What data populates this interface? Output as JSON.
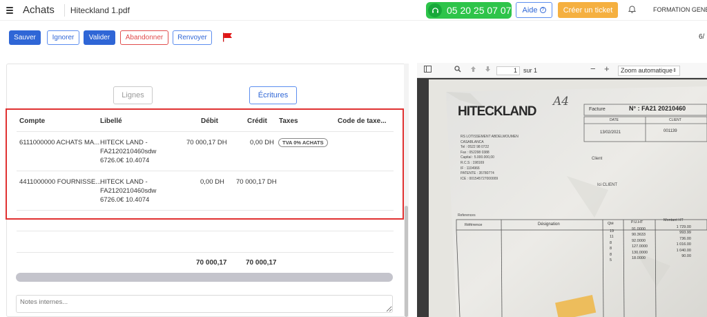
{
  "topbar": {
    "app_title": "Achats",
    "file_name": "Hiteckland 1.pdf",
    "phone": "05 20 25 07 07",
    "help_label": "Aide",
    "ticket_label": "Créer un ticket",
    "company": "FORMATION GENE"
  },
  "toolbar": {
    "save_label": "Sauver",
    "ignore_label": "Ignorer",
    "validate_label": "Valider",
    "abandon_label": "Abandonner",
    "resend_label": "Renvoyer",
    "pager": "6/"
  },
  "tabs": {
    "lines_label": "Lignes",
    "entries_label": "Écritures"
  },
  "table": {
    "headers": {
      "account": "Compte",
      "label": "Libellé",
      "debit": "Débit",
      "credit": "Crédit",
      "taxes": "Taxes",
      "tax_code": "Code de taxe..."
    },
    "rows": [
      {
        "account": "6111000000 ACHATS MA...",
        "label_1": "HITECK LAND -",
        "label_2": "FA2120210460sdw",
        "label_3": "6726.0€ 10.4074",
        "debit": "70 000,17 DH",
        "credit": "0,00 DH",
        "tax": "TVA 0% ACHATS"
      },
      {
        "account": "4411000000 FOURNISSE...",
        "label_1": "HITECK LAND -",
        "label_2": "FA2120210460sdw",
        "label_3": "6726.0€ 10.4074",
        "debit": "0,00 DH",
        "credit": "70 000,17 DH",
        "tax": ""
      }
    ],
    "totals": {
      "debit": "70 000,17",
      "credit": "70 000,17"
    }
  },
  "notes": {
    "placeholder": "Notes internes..."
  },
  "pdf_viewer": {
    "page": "1",
    "page_total": "sur 1",
    "zoom": "Zoom automatique"
  },
  "scan": {
    "brand": "HITECKLAND",
    "handwritten": "A4",
    "invoice_label": "Facture",
    "invoice_number": "N° : FA21 20210460",
    "date_header": "DATE",
    "client_header": "CLIENT",
    "date": "13/02/2021",
    "client_code": "001139",
    "client_label": "Client",
    "client_name": "Ici CLIENT",
    "address_lines": [
      "RS LOTISSEMENT ABDELMOUMEN",
      "CASABLANCA",
      "Tel   : 0522 98 0722",
      "Fax   : 052298 0388",
      "Capital : 5.000.000,00",
      "R.C.S  : 198169",
      "IF     : 1104966",
      "PATENTE : 35780774",
      "ICE    : 001545727000009"
    ],
    "references_label": "References",
    "columns": [
      "Référence",
      "Désignation",
      "Qté",
      "P.U.HT",
      "Montant HT"
    ],
    "qty": [
      "19",
      "11",
      "8",
      "8",
      "8",
      "5"
    ],
    "unit_prices": [
      "91.0000",
      "90.3633",
      "92.0000",
      "127.0000",
      "130.0000",
      "18.0000"
    ],
    "amounts": [
      "1 729.00",
      "993.99",
      "736.00",
      "1 016.00",
      "1 040.00",
      "90.00"
    ]
  },
  "colors": {
    "primary": "#2f66d6",
    "danger": "#e04b4b",
    "phone_green": "#2ec44a",
    "ticket_orange": "#f5b040",
    "highlight_red": "#e03030"
  }
}
